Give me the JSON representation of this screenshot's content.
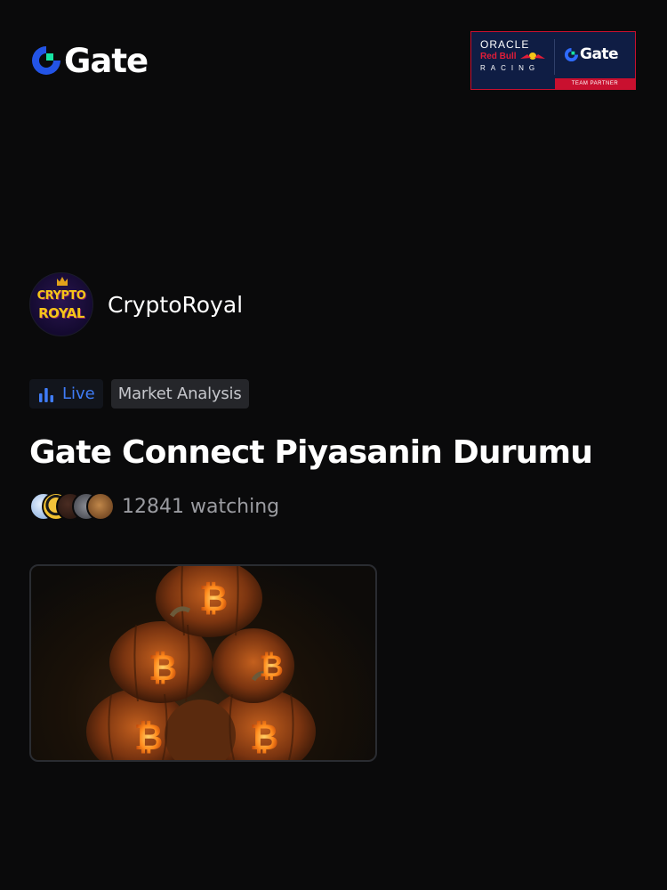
{
  "header": {
    "logo_text": "Gate",
    "logo_icon": "gate-logo-icon",
    "brand_color": "#2354e6",
    "accent_color": "#17e5a3"
  },
  "partner_banner": {
    "line1": "ORACLE",
    "line2": "Red Bull",
    "line3": "RACING",
    "gate_text": "Gate",
    "strip_text": "TEAM PARTNER",
    "background": "#0f1d44",
    "strip_color": "#c9102f"
  },
  "host": {
    "avatar_line1": "CRYPTO",
    "avatar_line2": "ROYAL",
    "name": "CryptoRoyal"
  },
  "tags": {
    "live_label": "Live",
    "live_icon": "bar-chart-icon",
    "live_color": "#3f7cf7",
    "category_label": "Market Analysis"
  },
  "stream": {
    "title": "Gate Connect Piyasanin Durumu",
    "watching_text": "12841 watching",
    "viewer_avatar_count": 5,
    "thumbnail": "halloween-bitcoin-pumpkins"
  }
}
